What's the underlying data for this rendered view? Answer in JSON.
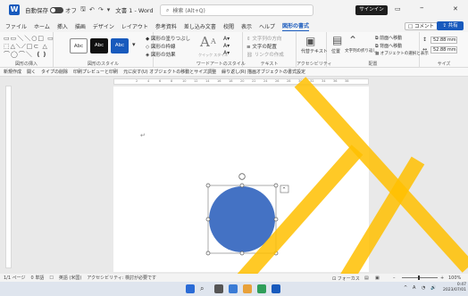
{
  "titlebar": {
    "app_icon": "W",
    "autosave_label": "自動保存",
    "autosave_state": "オフ",
    "doc_title": "文書 1 - Word",
    "search_placeholder": "検索 (Alt+Q)",
    "signin_label": "サインイン",
    "minimize": "–",
    "close": "✕",
    "quick_icons": [
      "save-icon",
      "undo-icon",
      "redo-icon",
      "customize-icon"
    ]
  },
  "menu": {
    "items": [
      "ファイル",
      "ホーム",
      "挿入",
      "描画",
      "デザイン",
      "レイアウト",
      "参考資料",
      "差し込み文書",
      "校閲",
      "表示",
      "ヘルプ",
      "図形の書式"
    ],
    "active": "図形の書式",
    "comment_label": "コメント",
    "share_label": "共有"
  },
  "ribbon": {
    "groups": {
      "insert_shapes": "図形の挿入",
      "shape_styles": "図形のスタイル",
      "wordart_styles": "ワードアートのスタイル",
      "text": "テキスト",
      "accessibility": "アクセシビリティ",
      "arrange": "配置",
      "size": "サイズ"
    },
    "style_swatches": [
      "Abc",
      "Abc",
      "Abc"
    ],
    "shape_fill": "図形の塗りつぶし",
    "shape_outline": "図形の枠線",
    "shape_effects": "図形の効果",
    "quick_styles": "クイック スタイル",
    "text_direction": "文字列の方向",
    "align_text": "文字の配置",
    "create_link": "リンクの作成",
    "alt_text": "代替テキスト",
    "position": "位置",
    "wrap_text": "文字列の折り返し",
    "bring_forward": "前面へ移動",
    "send_backward": "背面へ移動",
    "selection_pane": "オブジェクトの選択と表示",
    "height": "52.88 mm",
    "width": "52.88 mm"
  },
  "formatbar": {
    "items": [
      "新規作成",
      "開く",
      "タイプの削除",
      "印刷プレビューと印刷",
      "元に戻す(U) オブジェクトの移動とサイズ調整",
      "繰り返し(R) 描画オブジェクトの書式設定"
    ]
  },
  "statusbar": {
    "page": "1/1 ページ",
    "words": "0 単語",
    "language": "英語 (米国)",
    "accessibility": "アクセシビリティ: 検討が必要です",
    "focus": "フォーカス",
    "zoom": "100%"
  },
  "tray": {
    "time": "0:47",
    "date": "2023/07/01"
  },
  "colors": {
    "accent": "#185abd",
    "circle_fill": "#4472c4",
    "watermark": "#ffc000"
  }
}
